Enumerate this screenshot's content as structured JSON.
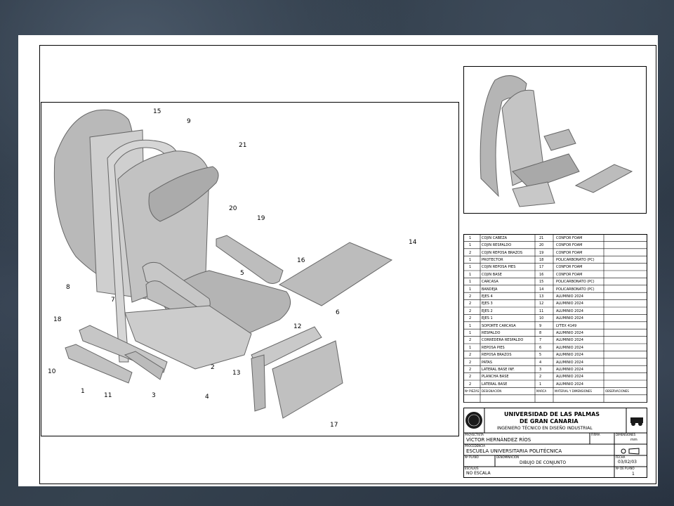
{
  "title_block": {
    "university_line1": "UNIVERSIDAD DE LAS PALMAS",
    "university_line2": "DE GRAN CANARIA",
    "degree": "INGENIERO TÉCNICO EN DISEÑO INDUSTRIAL",
    "author_label": "PROYECTISTA",
    "author": "VÍCTOR HERNÁNDEZ RÍOS",
    "school_label": "PROCEDENCIA",
    "school": "ESCUELA UNIVERSITARIA POLITÉCNICA",
    "drawing_label": "DENOMINACIÓN",
    "drawing_name": "DIBUJO DE CONJUNTO",
    "scale_label": "ESCALA/S",
    "scale": "NO ESCALA",
    "signature_label": "FIRMA",
    "dimensions_label": "DIMENSIONES",
    "dimensions_value": "mm",
    "date_label": "FECHA",
    "date": "03/02/03",
    "sheet_label": "Nº DE PLANO",
    "sheet": "1",
    "plano_label": "Nº PLANO"
  },
  "parts_table": {
    "headers": [
      "Nº PIEZAS",
      "DESIGNACIÓN",
      "MARCA",
      "MATERIAL Y DIMENSIONES",
      "OBSERVACIONES"
    ],
    "rows": [
      {
        "qty": "1",
        "name": "COJIN CABEZA",
        "mark": "21",
        "material": "CONFOR FOAM"
      },
      {
        "qty": "1",
        "name": "COJIN RESPALDO",
        "mark": "20",
        "material": "CONFOR FOAM"
      },
      {
        "qty": "2",
        "name": "COJIN REPOSA BRAZOS",
        "mark": "19",
        "material": "CONFOR FOAM"
      },
      {
        "qty": "1",
        "name": "PROTECTOR",
        "mark": "18",
        "material": "POLICARBONATO (PC)"
      },
      {
        "qty": "1",
        "name": "COJIN REPOSA PIES",
        "mark": "17",
        "material": "CONFOR FOAM"
      },
      {
        "qty": "1",
        "name": "COJIN BASE",
        "mark": "16",
        "material": "CONFOR FOAM"
      },
      {
        "qty": "1",
        "name": "CARCASA",
        "mark": "15",
        "material": "POLICARBONATO (PC)"
      },
      {
        "qty": "1",
        "name": "BANDEJA",
        "mark": "14",
        "material": "POLICARBONATO (PC)"
      },
      {
        "qty": "2",
        "name": "EJES 4",
        "mark": "13",
        "material": "ALUMINIO 2024"
      },
      {
        "qty": "2",
        "name": "EJES 3",
        "mark": "12",
        "material": "ALUMINIO 2024"
      },
      {
        "qty": "2",
        "name": "EJES 2",
        "mark": "11",
        "material": "ALUMINIO 2024"
      },
      {
        "qty": "2",
        "name": "EJES 1",
        "mark": "10",
        "material": "ALUMINIO 2024"
      },
      {
        "qty": "1",
        "name": "SOPORTE CARCASA",
        "mark": "9",
        "material": "LYTEX 4149"
      },
      {
        "qty": "1",
        "name": "RESPALDO",
        "mark": "8",
        "material": "ALUMINIO 2024"
      },
      {
        "qty": "2",
        "name": "CORREDERA RESPALDO",
        "mark": "7",
        "material": "ALUMINIO 2024"
      },
      {
        "qty": "1",
        "name": "REPOSA PIES",
        "mark": "6",
        "material": "ALUMINIO 2024"
      },
      {
        "qty": "2",
        "name": "REPOSA BRAZOS",
        "mark": "5",
        "material": "ALUMINIO 2024"
      },
      {
        "qty": "2",
        "name": "PATAS",
        "mark": "4",
        "material": "ALUMINIO 2024"
      },
      {
        "qty": "2",
        "name": "LATERAL BASE INF.",
        "mark": "3",
        "material": "ALUMINIO 2024"
      },
      {
        "qty": "2",
        "name": "PLANCHA BASE",
        "mark": "2",
        "material": "ALUMINIO 2024"
      },
      {
        "qty": "2",
        "name": "LATERAL BASE",
        "mark": "1",
        "material": "ALUMINIO 2024"
      }
    ]
  },
  "balloons": [
    "15",
    "9",
    "21",
    "20",
    "19",
    "16",
    "14",
    "8",
    "7",
    "5",
    "18",
    "10",
    "11",
    "1",
    "3",
    "4",
    "2",
    "12",
    "13",
    "6",
    "17"
  ]
}
